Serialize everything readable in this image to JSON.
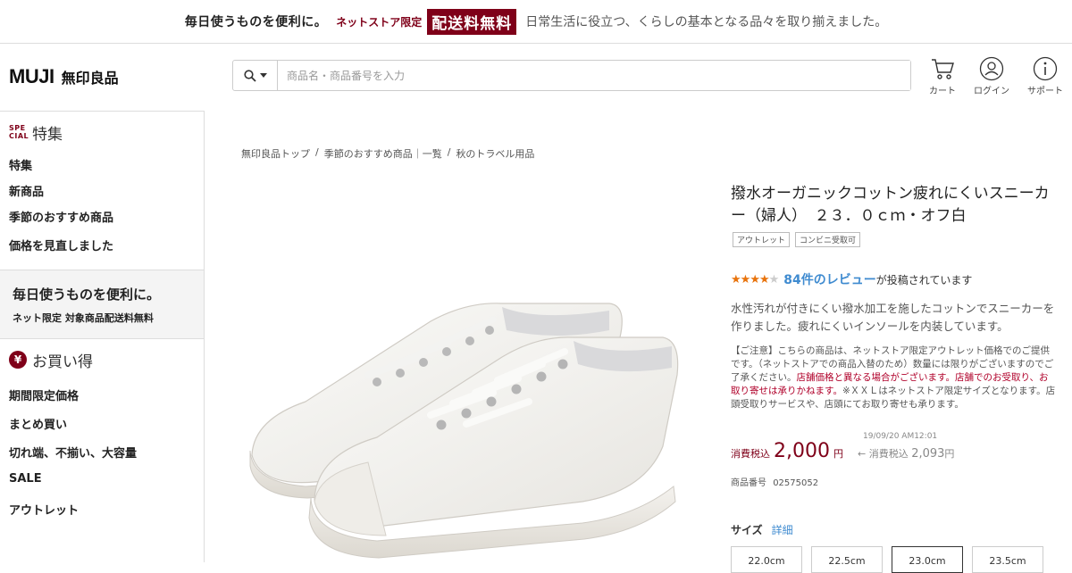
{
  "banner": {
    "main": "毎日使うものを便利に。",
    "net_only": "ネットストア限定",
    "free_shipping": "配送料無料",
    "sub": "日常生活に役立つ、くらしの基本となる品々を取り揃えました。"
  },
  "header": {
    "logo_en": "MUJI",
    "logo_jp": "無印良品",
    "search_placeholder": "商品名・商品番号を入力",
    "cart_label": "カート",
    "login_label": "ログイン",
    "support_label": "サポート"
  },
  "sidebar": {
    "special_mark": "SPE CIAL",
    "special_title": "特集",
    "special_items": [
      "特集",
      "新商品",
      "季節のおすすめ商品",
      "価格を見直しました"
    ],
    "promo_title": "毎日使うものを便利に。",
    "promo_sub": "ネット限定 対象商品配送料無料",
    "deals_mark": "¥",
    "deals_title": "お買い得",
    "deal_items": [
      "期間限定価格",
      "まとめ買い",
      "切れ端、不揃い、大容量",
      "SALE",
      "アウトレット"
    ]
  },
  "breadcrumb": [
    "無印良品トップ",
    "季節のおすすめ商品｜一覧",
    "秋のトラベル用品"
  ],
  "breadcrumb_sep": "/",
  "product": {
    "title": "撥水オーガニックコットン疲れにくいスニーカー（婦人）　２３．０ｃｍ・オフ白",
    "tags": [
      "アウトレット",
      "コンビニ受取可"
    ],
    "rating": 4,
    "review_link": "84件のレビュー",
    "review_suffix": "が投稿されています",
    "description": "水性汚れが付きにくい撥水加工を施したコットンでスニーカーを作りました。疲れにくいインソールを内装しています。",
    "notice_1": "【ご注意】こちらの商品は、ネットストア限定アウトレット価格でのご提供です。（ネットストアでの商品入替のため）数量には限りがございますのでご了承ください。",
    "notice_red_1": "店舗価格と異なる場合がございます。店舗でのお受取り、お取り寄せは承りかねます。",
    "notice_2": "※ＸＸＬはネットストア限定サイズとなります。店頭受取りサービスや、店頭にてお取り寄せも承ります。",
    "price_timestamp": "19/09/20 AM12:01",
    "price_label": "消費税込",
    "price": "2,000",
    "price_unit": "円",
    "prev_price_label": "← 消費税込",
    "prev_price": "2,093",
    "prev_price_unit": "円",
    "code_label": "商品番号",
    "code": "02575052",
    "size_label": "サイズ",
    "size_detail_link": "詳細",
    "sizes": [
      "22.0cm",
      "22.5cm",
      "23.0cm",
      "23.5cm"
    ],
    "selected_size_index": 2
  },
  "colors": {
    "brand": "#7f0019",
    "link": "#3f8bd0",
    "star": "#e8730c"
  }
}
